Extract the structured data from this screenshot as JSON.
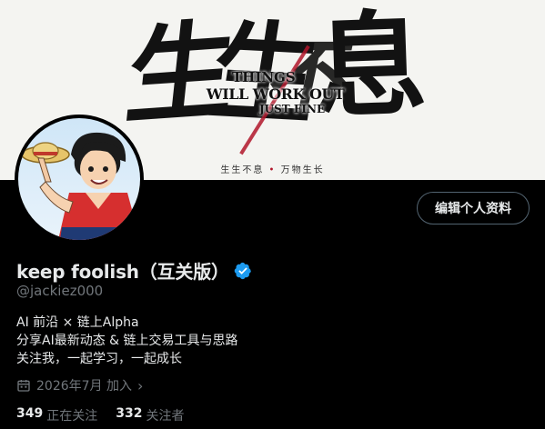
{
  "banner": {
    "calligraphy": [
      "生",
      "生",
      "不",
      "息"
    ],
    "overlay_lines": [
      "THINGS",
      "WILL WORK OUT",
      "JUST FINE"
    ],
    "subline_left": "生生不息",
    "subline_dot": "•",
    "subline_right": "万物生长"
  },
  "profile": {
    "display_name": "keep foolish（互关版）",
    "handle": "@jackiez000",
    "edit_button": "编辑个人资料",
    "bio": [
      "AI 前沿 × 链上Alpha",
      "分享AI最新动态 & 链上交易工具与思路",
      "关注我，一起学习，一起成长"
    ],
    "joined": "2026年7月 加入",
    "following_count": "349",
    "following_label": "正在关注",
    "followers_count": "332",
    "followers_label": "关注者"
  },
  "icons": {
    "verified": "verified-badge-icon",
    "calendar": "calendar-icon",
    "chevron": "chevron-right-icon"
  },
  "colors": {
    "background": "#000000",
    "verified": "#1d9bf0",
    "secondary_text": "#71767b",
    "banner_accent": "#b0152a"
  }
}
